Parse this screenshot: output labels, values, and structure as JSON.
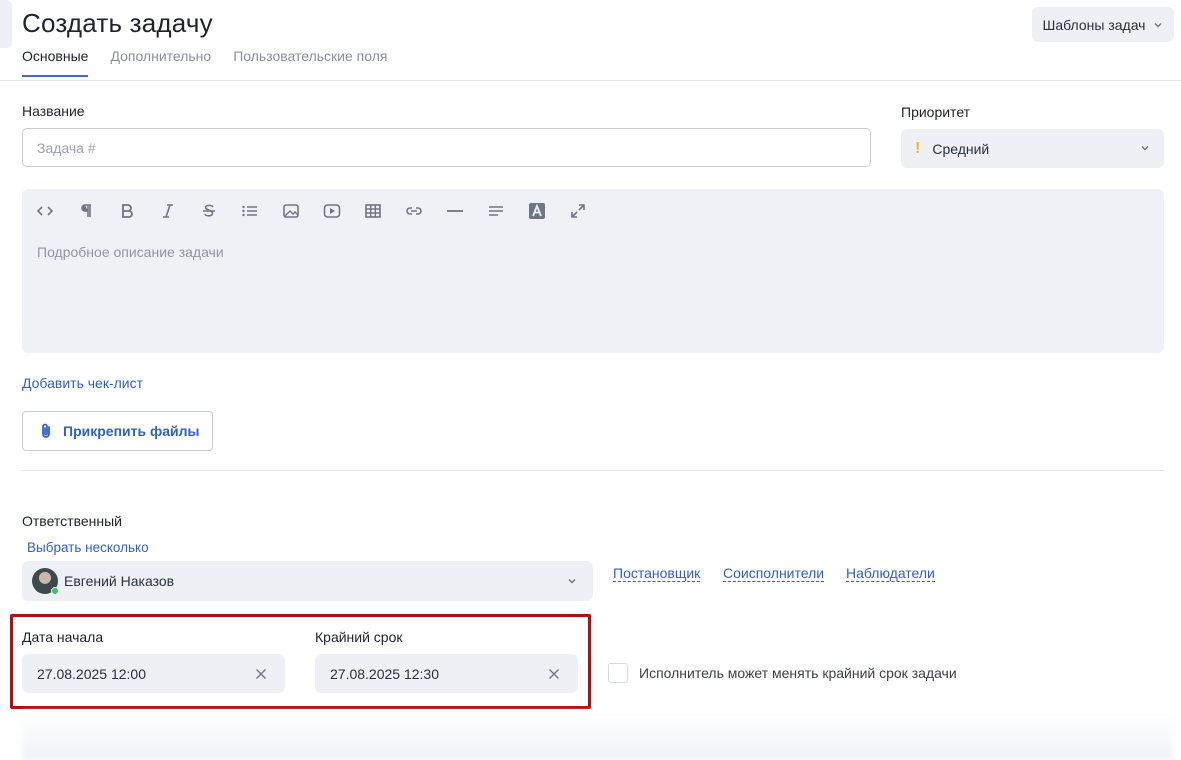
{
  "header": {
    "title": "Создать задачу",
    "templates_label": "Шаблоны задач"
  },
  "tabs": [
    {
      "label": "Основные",
      "active": true
    },
    {
      "label": "Дополнительно",
      "active": false
    },
    {
      "label": "Пользовательские поля",
      "active": false
    }
  ],
  "form": {
    "name_label": "Название",
    "name_placeholder": "Задача #",
    "name_value": "",
    "priority_label": "Приоритет",
    "priority_value": "Средний",
    "priority_icon": "exclamation-icon",
    "editor_placeholder": "Подробное описание задачи",
    "editor_toolbar": [
      "code-icon",
      "paragraph-icon",
      "bold-icon",
      "italic-icon",
      "strikethrough-icon",
      "list-icon",
      "image-icon",
      "video-icon",
      "table-icon",
      "link-icon",
      "horizontal-rule-icon",
      "align-icon",
      "text-color-icon",
      "fullscreen-icon"
    ],
    "add_checklist": "Добавить чек-лист",
    "attach_files": "Прикрепить файлы"
  },
  "assignment": {
    "responsible_label": "Ответственный",
    "select_multiple": "Выбрать несколько",
    "assignee_name": "Евгений Наказов",
    "links": [
      "Постановщик",
      "Соисполнители",
      "Наблюдатели"
    ]
  },
  "dates": {
    "start_label": "Дата начала",
    "start_value": "27.08.2025 12:00",
    "deadline_label": "Крайний срок",
    "deadline_value": "27.08.2025 12:30",
    "can_change_deadline_label": "Исполнитель может менять крайний срок задачи",
    "can_change_deadline_checked": false
  },
  "colors": {
    "accent": "#2f5fd6",
    "highlight": "#b30d0d",
    "priority": "#f5b800",
    "online": "#43c15a"
  }
}
